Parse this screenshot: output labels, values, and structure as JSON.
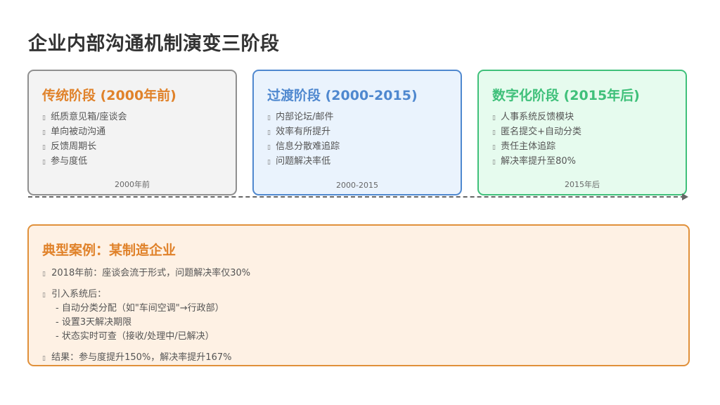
{
  "title": "企业内部沟通机制演变三阶段",
  "stages": [
    {
      "title": "传统阶段 (2000年前)",
      "items": [
        "纸质意见箱/座谈会",
        "单向被动沟通",
        "反馈周期长",
        "参与度低"
      ],
      "footer": "2000年前"
    },
    {
      "title": "过渡阶段 (2000-2015)",
      "items": [
        "内部论坛/邮件",
        "效率有所提升",
        "信息分散难追踪",
        "问题解决率低"
      ],
      "footer": "2000-2015"
    },
    {
      "title": "数字化阶段 (2015年后)",
      "items": [
        "人事系统反馈模块",
        "匿名提交+自动分类",
        "责任主体追踪",
        "解决率提升至80%"
      ],
      "footer": "2015年后"
    }
  ],
  "case": {
    "title": "典型案例：某制造企业",
    "before": "2018年前：座谈会流于形式，问题解决率仅30%",
    "intro": "引入系统后：",
    "details": [
      "- 自动分类分配（如\"车间空调\"→行政部）",
      "- 设置3天解决期限",
      "- 状态实时可查（接收/处理中/已解决）"
    ],
    "result": "结果：参与度提升150%，解决率提升167%"
  },
  "colors": {
    "traditional": "#e0822a",
    "transition": "#4f88cf",
    "digital": "#3fc07a",
    "case_border": "#e0903a"
  }
}
